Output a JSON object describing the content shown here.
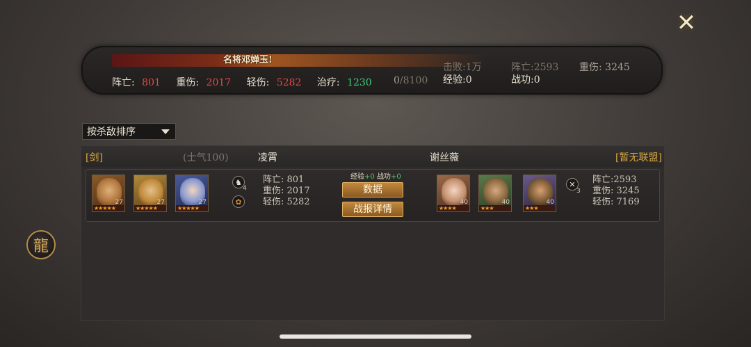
{
  "summary": {
    "banner_text": "名将邓婵玉!",
    "dead_label": "阵亡:",
    "dead_value": "801",
    "heavy_label": "重伤:",
    "heavy_value": "2017",
    "light_label": "轻伤:",
    "light_value": "5282",
    "heal_label": "治疗:",
    "heal_value": "1230",
    "progress_current": "0",
    "progress_total": "/8100",
    "defeat_text": "击败:1万",
    "right_dead_text": "阵亡:2593",
    "right_heavy_text": "重伤: 3245",
    "exp_text": "经验:0",
    "merit_text": "战功:0"
  },
  "sort": {
    "label": "按杀敌排序"
  },
  "panel": {
    "left_tag": "[剑]",
    "morale": "(士气100)",
    "left_name": "凌霄",
    "right_name": "谢丝薇",
    "right_tag": "[暂无联盟]"
  },
  "row": {
    "left_heroes": [
      {
        "level": "27",
        "stars": "★★★★★"
      },
      {
        "level": "27",
        "stars": "★★★★★"
      },
      {
        "level": "27",
        "stars": "★★★★★"
      }
    ],
    "right_heroes": [
      {
        "level": "40",
        "stars": "★★★★"
      },
      {
        "level": "40",
        "stars": "★★★"
      },
      {
        "level": "40",
        "stars": "★★★"
      }
    ],
    "left_skill_count": "4",
    "right_skill_count": "3",
    "left_stats": [
      "阵亡: 801",
      "重伤: 2017",
      "轻伤: 5282"
    ],
    "right_stats": [
      "阵亡:2593",
      "重伤: 3245",
      "轻伤: 7169"
    ],
    "reward_exp_label": "经验",
    "reward_exp_value": "+0",
    "reward_merit_label": "战功",
    "reward_merit_value": "+0",
    "data_button": "数据",
    "report_button": "战报详情"
  },
  "icons": {
    "close": "close-icon",
    "emblem": "dragon-emblem-icon"
  }
}
